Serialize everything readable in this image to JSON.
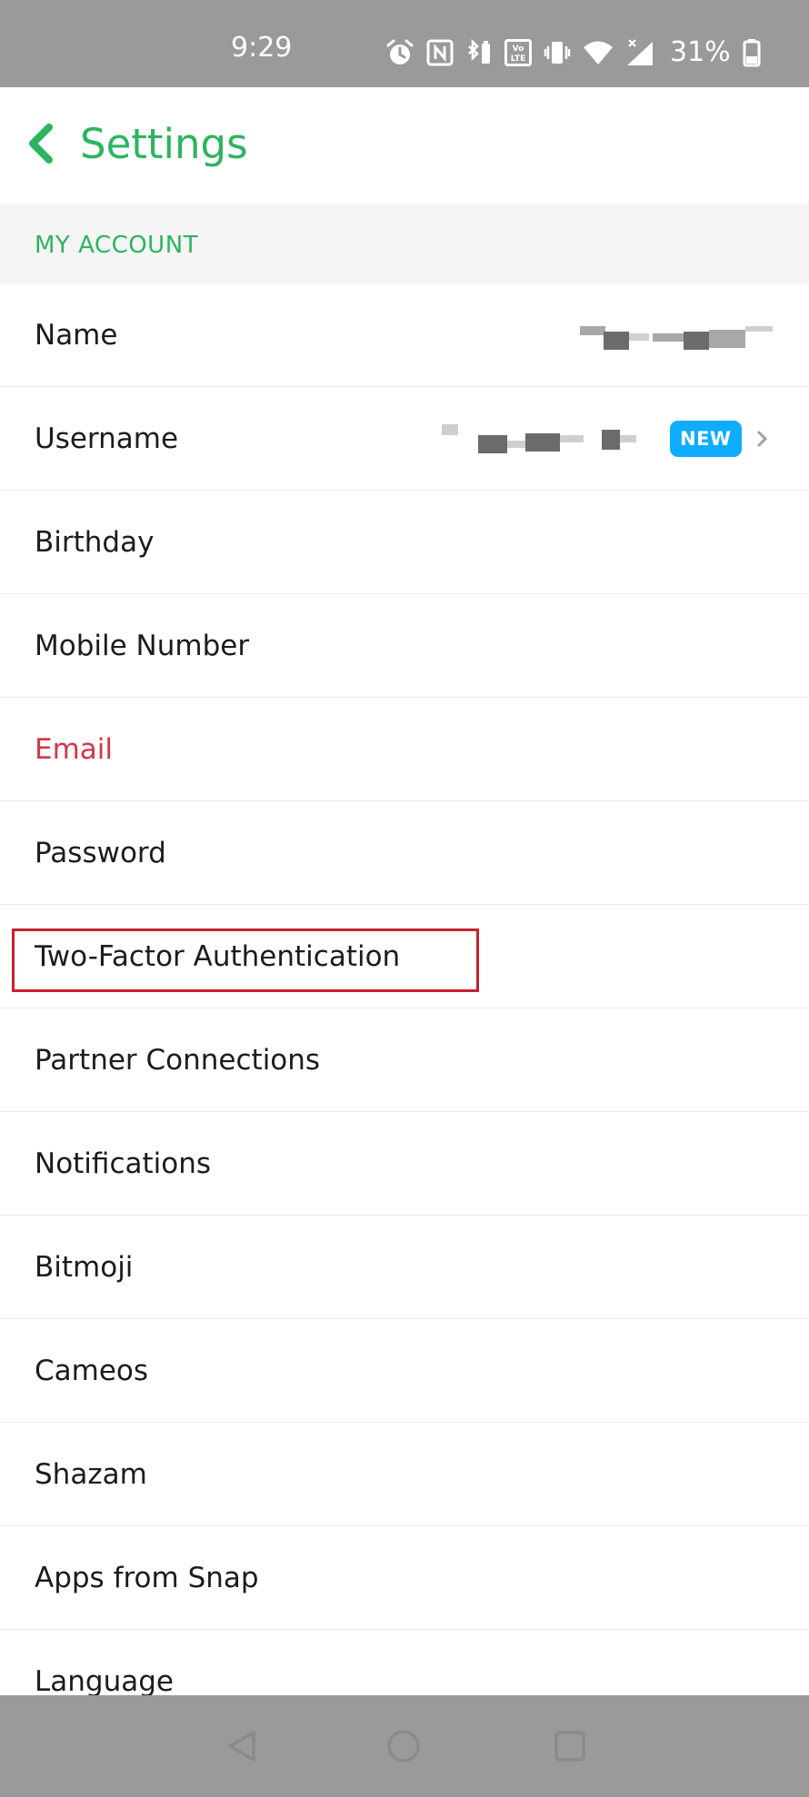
{
  "status_bar": {
    "time": "9:29",
    "battery_text": "31%",
    "icons": [
      "alarm-icon",
      "nfc-icon",
      "bluetooth-battery-icon",
      "volte-icon",
      "vibrate-icon",
      "wifi-icon",
      "signal-icon",
      "battery-icon"
    ]
  },
  "header": {
    "title": "Settings",
    "back_icon": "chevron-left-icon"
  },
  "section": {
    "title": "MY ACCOUNT"
  },
  "colors": {
    "accent": "#2db45e",
    "danger": "#d2374a",
    "badge": "#0eadff",
    "highlight": "#c8202d"
  },
  "settings_items": [
    {
      "label": "Name"
    },
    {
      "label": "Username",
      "badge": "NEW"
    },
    {
      "label": "Birthday"
    },
    {
      "label": "Mobile Number"
    },
    {
      "label": "Email"
    },
    {
      "label": "Password"
    },
    {
      "label": "Two-Factor Authentication"
    },
    {
      "label": "Partner Connections"
    },
    {
      "label": "Notifications"
    },
    {
      "label": "Bitmoji"
    },
    {
      "label": "Cameos"
    },
    {
      "label": "Shazam"
    },
    {
      "label": "Apps from Snap"
    },
    {
      "label": "Language"
    }
  ],
  "nav_bar": {
    "icons": [
      "back-triangle-icon",
      "home-circle-icon",
      "recents-square-icon"
    ]
  }
}
